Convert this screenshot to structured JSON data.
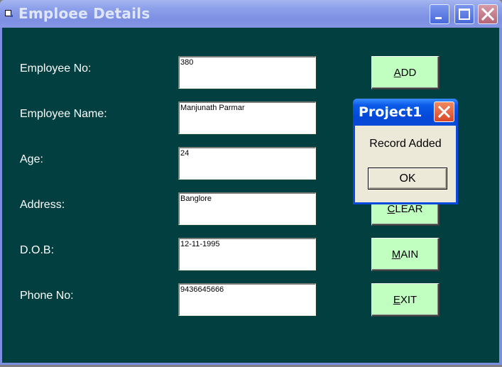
{
  "window": {
    "title": "Emploee Details",
    "controls": {
      "minimize": "minimize-icon",
      "maximize": "maximize-icon",
      "close": "close-icon"
    }
  },
  "form": {
    "fields": [
      {
        "label": "Employee No:",
        "value": "380"
      },
      {
        "label": "Employee Name:",
        "value": "Manjunath Parmar"
      },
      {
        "label": "Age:",
        "value": "24"
      },
      {
        "label": "Address:",
        "value": "Banglore"
      },
      {
        "label": "D.O.B:",
        "value": "12-11-1995"
      },
      {
        "label": "Phone No:",
        "value": "9436645666"
      }
    ],
    "buttons": [
      {
        "accel": "A",
        "rest": "DD"
      },
      {
        "accel": "C",
        "rest": "LEAR"
      },
      {
        "accel": "M",
        "rest": "AIN"
      },
      {
        "accel": "E",
        "rest": "XIT"
      }
    ],
    "colors": {
      "background": "#023f40",
      "button": "#c0ffc0"
    }
  },
  "dialog": {
    "title": "Project1",
    "message": "Record Added",
    "ok_label": "OK"
  }
}
